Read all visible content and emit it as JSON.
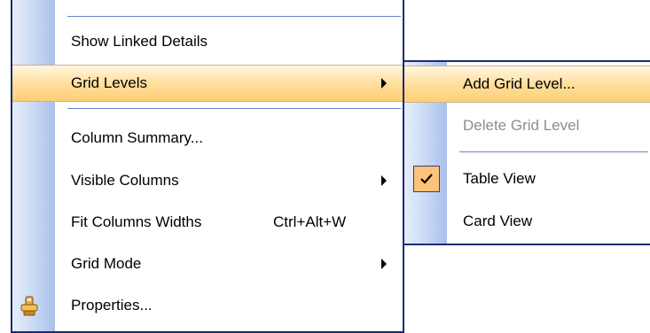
{
  "main_menu": {
    "items": [
      {
        "label": "Show Linked Details"
      },
      {
        "label": "Grid Levels"
      },
      {
        "label": "Column Summary..."
      },
      {
        "label": "Visible Columns"
      },
      {
        "label": "Fit Columns Widths",
        "shortcut": "Ctrl+Alt+W"
      },
      {
        "label": "Grid Mode"
      },
      {
        "label": "Properties...",
        "icon": "properties-icon"
      }
    ]
  },
  "grid_levels_submenu": {
    "items": [
      {
        "label": "Add Grid Level..."
      },
      {
        "label": "Delete Grid Level",
        "disabled": true
      },
      {
        "label": "Table View",
        "checked": true,
        "icon": "checkmark-icon"
      },
      {
        "label": "Card View"
      }
    ]
  },
  "colors": {
    "menu_border": "#1a2c74",
    "highlight": "#ffdd98",
    "check_background": "#ffc27a",
    "disabled_text": "#8d8d8d"
  }
}
